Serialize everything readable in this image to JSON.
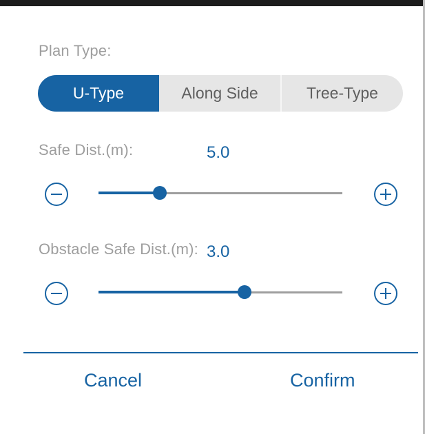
{
  "dialog": {
    "plan_type": {
      "label": "Plan Type:",
      "options": [
        "U-Type",
        "Along Side",
        "Tree-Type"
      ],
      "selected": "U-Type"
    },
    "safe_dist": {
      "label": "Safe Dist.(m):",
      "value": "5.0",
      "slider_fraction": 0.25
    },
    "obstacle_safe_dist": {
      "label": "Obstacle Safe Dist.(m):",
      "value": "3.0",
      "slider_fraction": 0.6
    },
    "actions": {
      "cancel_label": "Cancel",
      "confirm_label": "Confirm"
    }
  },
  "colors": {
    "accent": "#1763a3",
    "label_gray": "#9e9e9e",
    "segment_bg": "#e6e6e6"
  },
  "icons": {
    "decrease": "minus-circle-icon",
    "increase": "plus-circle-icon"
  }
}
